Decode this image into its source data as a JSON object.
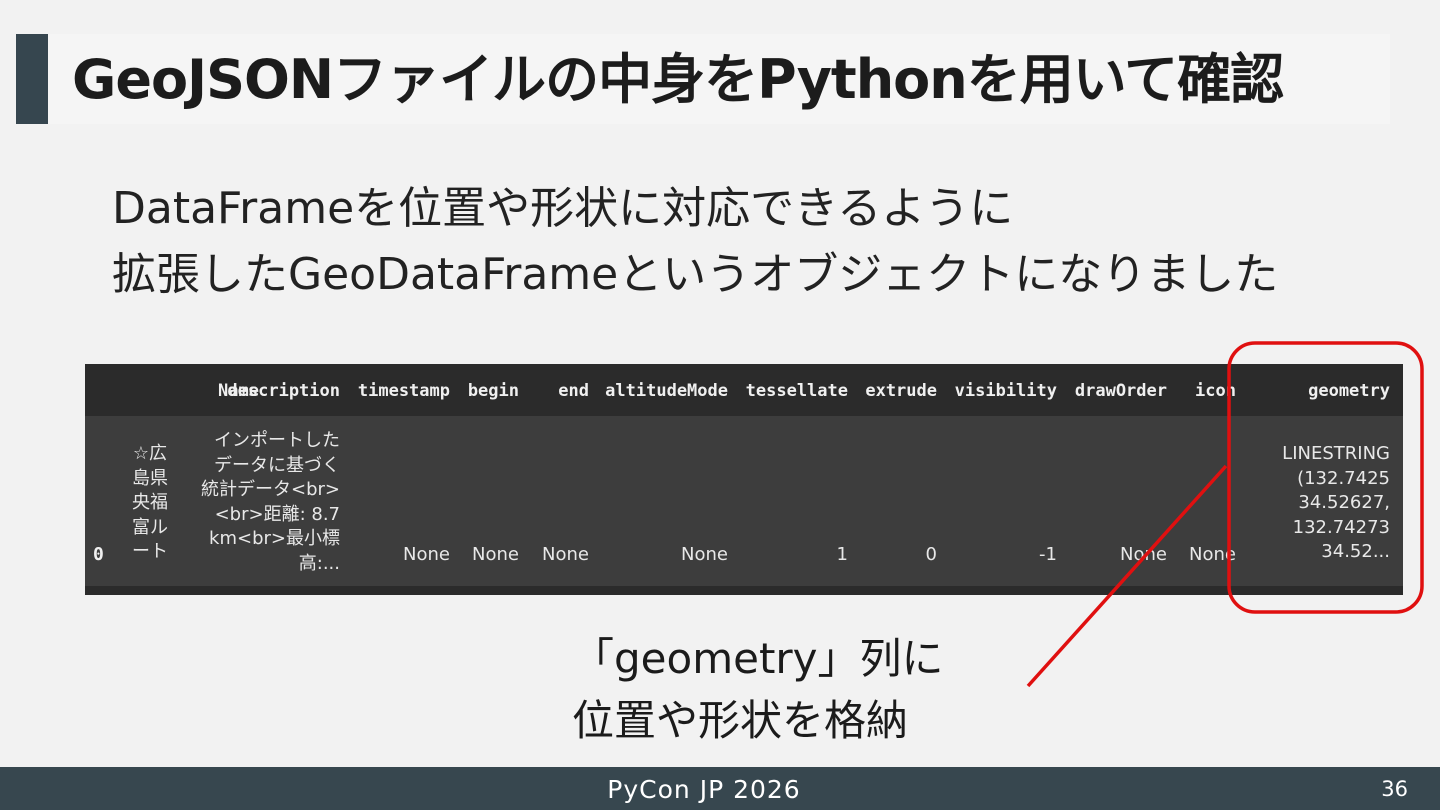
{
  "slide": {
    "title": "GeoJSONファイルの中身をPythonを用いて確認",
    "subtitle_lines": [
      "DataFrameを位置や形状に対応できるように",
      "拡張したGeoDataFrameというオブジェクトになりました"
    ],
    "annotation_lines": [
      "「geometry」列に",
      "位置や形状を格納"
    ],
    "footer_title": "PyCon JP 2026",
    "page_number": "36"
  },
  "dataframe": {
    "columns": [
      "Name",
      "description",
      "timestamp",
      "begin",
      "end",
      "altitudeMode",
      "tessellate",
      "extrude",
      "visibility",
      "drawOrder",
      "icon",
      "geometry"
    ],
    "rows": [
      {
        "index": "0",
        "cells": [
          [
            "☆広",
            "島県",
            "央福",
            "富ル",
            "ート"
          ],
          [
            "インポートした",
            "データに基づく",
            "統計データ<br>",
            "<br>距離: 8.7",
            "km<br>最小標",
            "高:..."
          ],
          "None",
          "None",
          "None",
          "None",
          "1",
          "0",
          "-1",
          "None",
          "None",
          [
            "LINESTRING",
            "(132.7425",
            "34.52627,",
            "132.74273",
            "34.52..."
          ]
        ]
      }
    ]
  },
  "colors": {
    "highlight": "#e01010",
    "title_accent": "#36464f",
    "footer_bg": "#37474f",
    "table_header_bg": "#2b2b2b",
    "table_body_bg": "#3d3d3d"
  }
}
